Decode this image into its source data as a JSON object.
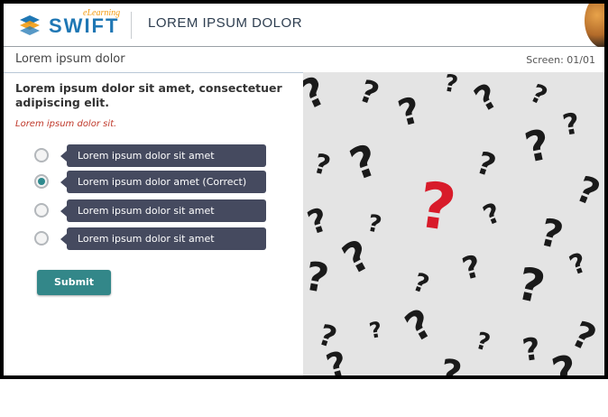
{
  "header": {
    "logo_word": "SWIFT",
    "logo_sub": "eLearning",
    "course_title": "LOREM IPSUM DOLOR"
  },
  "subheader": {
    "screen_title": "Lorem ipsum dolor",
    "screen_counter": "Screen: 01/01"
  },
  "quiz": {
    "question": "Lorem ipsum dolor sit amet, consectetuer adipiscing elit.",
    "instruction": "Lorem ipsum dolor sit.",
    "options": [
      {
        "label": "Lorem ipsum dolor sit amet",
        "selected": false
      },
      {
        "label": "Lorem ipsum dolor amet (Correct)",
        "selected": true
      },
      {
        "label": "Lorem ipsum dolor sit amet",
        "selected": false
      },
      {
        "label": "Lorem ipsum dolor sit amet",
        "selected": false
      }
    ],
    "submit_label": "Submit"
  },
  "image": {
    "subject": "question-marks-photo",
    "accent_color": "#d81b2a"
  },
  "colors": {
    "brand_blue": "#1f77b4",
    "option_pill": "#454a5f",
    "submit_teal": "#338789",
    "instruction_red": "#c0392b"
  }
}
